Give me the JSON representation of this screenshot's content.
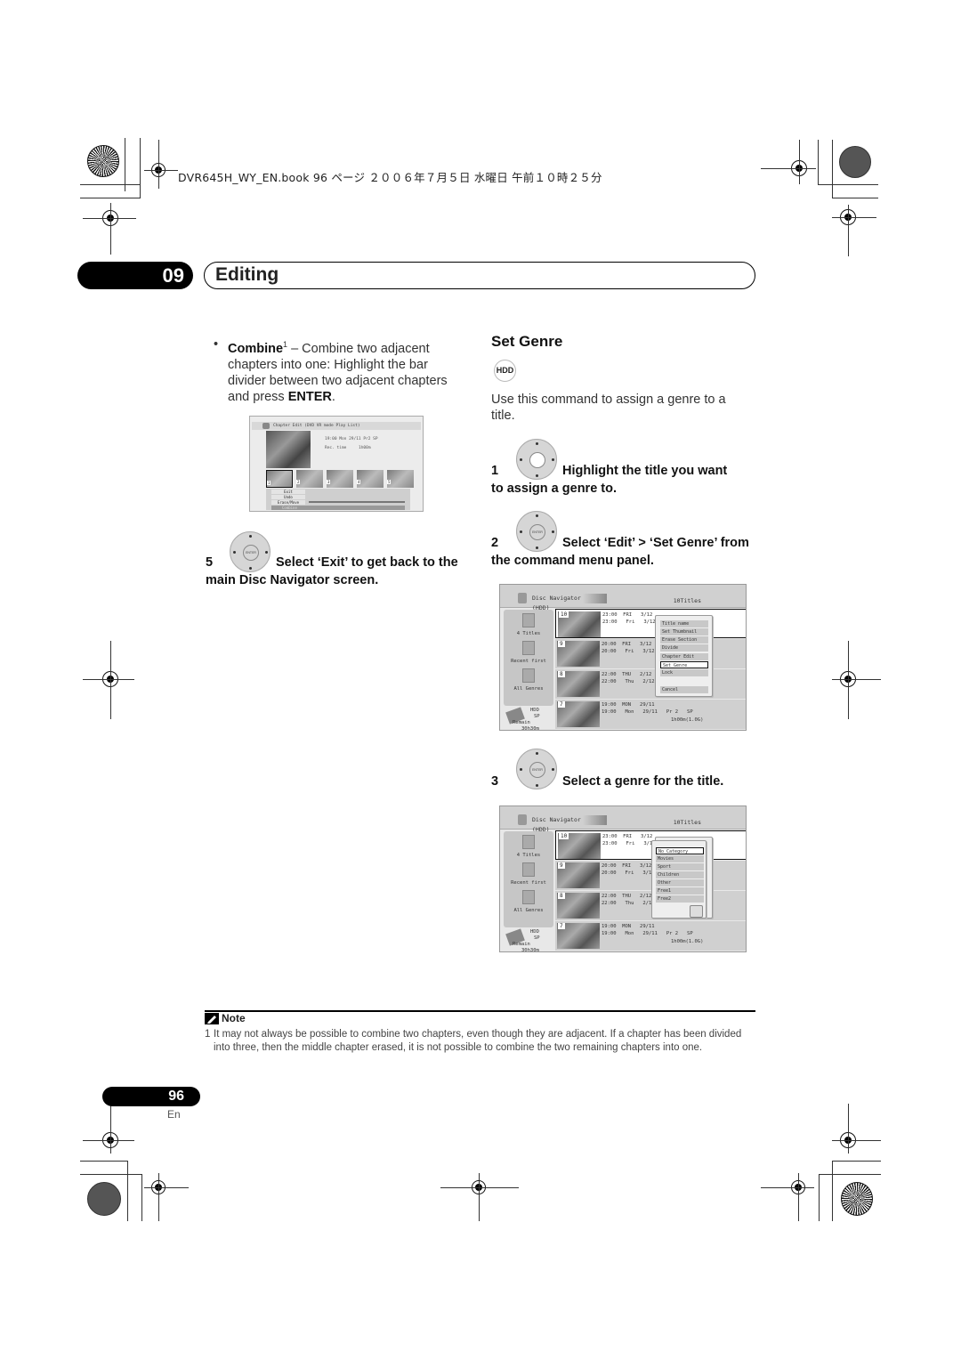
{
  "header": {
    "book_line": "DVR645H_WY_EN.book  96 ページ  ２００６年７月５日  水曜日  午前１０時２５分"
  },
  "chapter": {
    "number": "09",
    "title": "Editing"
  },
  "left_column": {
    "bullet": "•",
    "combine_term": "Combine",
    "combine_sup": "1",
    "combine_text_1": " – Combine two adjacent chapters into one: Highlight the bar divider between two adjacent chapters and press ",
    "combine_enter": "ENTER",
    "combine_period": ".",
    "chapter_edit_screen": {
      "title": "Chapter Edit (DVD VR mode Play List)",
      "info_line": "19:00  Mon  29/11  Pr2   SP",
      "rec_time_label": "Rec. time",
      "rec_time_value": "1h00m",
      "thumb_numbers": [
        "1",
        "2",
        "3",
        "4",
        "5"
      ],
      "menu_items": [
        "Exit",
        "Undo",
        "Erase/Move",
        "Combine"
      ]
    },
    "step5": {
      "number": "5",
      "text_a": "Select ‘Exit’ to get back to the",
      "text_b": "main Disc Navigator screen."
    }
  },
  "right_column": {
    "section_title": "Set Genre",
    "badge": "HDD",
    "intro": "Use this command to assign a genre to a title.",
    "step1": {
      "number": "1",
      "text_a": "Highlight the title you want",
      "text_b": "to assign a genre to."
    },
    "step2": {
      "number": "2",
      "text_a": "Select ‘Edit’ > ‘Set Genre’ from",
      "text_b": "the command menu panel."
    },
    "step3": {
      "number": "3",
      "text_a": "Select a genre for the title."
    },
    "enter_label": "ENTER"
  },
  "disc_navigator": {
    "title": "Disc Navigator (HDD)",
    "count": "10Titles",
    "side": {
      "titles": "4 Titles",
      "recent": "Recent first",
      "genres": "All Genres",
      "hdd": "HDD",
      "mode": "SP",
      "remain_label": "Remain",
      "remain_value": "30h30m"
    },
    "rows": [
      {
        "num": "10",
        "line1": "23:00  FRI   3/12",
        "line2": "23:00   Fri   3/12"
      },
      {
        "num": "9",
        "line1": "20:00  FRI   3/12",
        "line2": "20:00   Fri   3/12"
      },
      {
        "num": "8",
        "line1": "22:00  THU   2/12",
        "line2": "22:00   Thu   2/12"
      },
      {
        "num": "7",
        "line1": "19:00  MON   29/11",
        "line2": "19:00   Mon   29/11   Pr 2   SP",
        "line3": "1h00m(1.0G)"
      }
    ],
    "edit_menu": [
      "Title name",
      "Set Thumbnail",
      "Erase Section",
      "Divide",
      "Chapter Edit",
      "Set Genre",
      "Lock",
      "Cancel"
    ],
    "edit_menu_selected": "Set Genre",
    "genre_menu": [
      "No Category",
      "Movies",
      "Sport",
      "Children",
      "Other",
      "Free1",
      "Free2"
    ],
    "genre_menu_selected": "No Category"
  },
  "note": {
    "heading": "Note",
    "footnote_num": "1",
    "footnote_text": "It may not always be possible to combine two chapters, even though they are adjacent. If a chapter has been divided into three, then the middle chapter erased, it is not possible to combine the two remaining chapters into one."
  },
  "footer": {
    "page_number": "96",
    "language": "En"
  }
}
